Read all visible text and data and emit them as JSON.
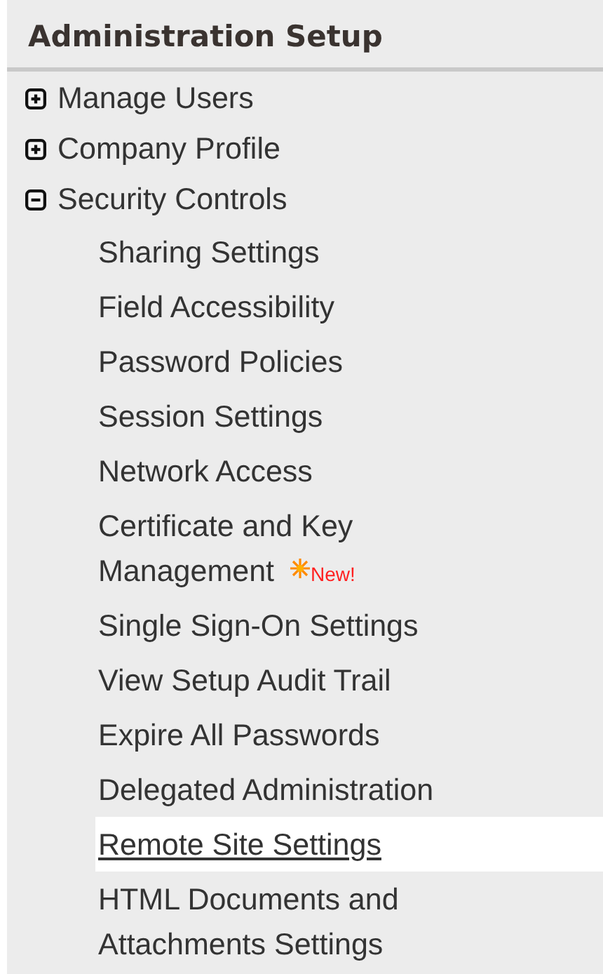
{
  "panel": {
    "title": "Administration Setup"
  },
  "items": [
    {
      "label": "Manage Users",
      "expanded": false
    },
    {
      "label": "Company Profile",
      "expanded": false
    },
    {
      "label": "Security Controls",
      "expanded": true,
      "children": [
        {
          "label": "Sharing Settings",
          "selected": false
        },
        {
          "label": "Field Accessibility",
          "selected": false
        },
        {
          "label": "Password Policies",
          "selected": false
        },
        {
          "label": "Session Settings",
          "selected": false
        },
        {
          "label": "Network Access",
          "selected": false
        },
        {
          "label": "Certificate and Key Management",
          "selected": false,
          "badge": "New!"
        },
        {
          "label": "Single Sign-On Settings",
          "selected": false
        },
        {
          "label": "View Setup Audit Trail",
          "selected": false
        },
        {
          "label": "Expire All Passwords",
          "selected": false
        },
        {
          "label": "Delegated Administration",
          "selected": false
        },
        {
          "label": "Remote Site Settings",
          "selected": true
        },
        {
          "label": "HTML Documents and Attachments Settings",
          "selected": false
        }
      ]
    }
  ]
}
